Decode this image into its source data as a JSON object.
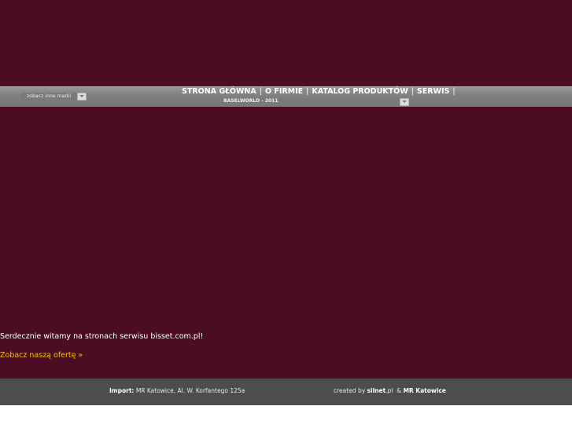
{
  "nav": {
    "brand_select": {
      "label": "zobacz inne marki"
    },
    "menu": [
      {
        "label": "STRONA GŁÓWNA"
      },
      {
        "label": "O FIRMIE"
      },
      {
        "label": "KATALOG PRODUKTÓW"
      },
      {
        "label": "SERWIS"
      }
    ],
    "separator": "|",
    "news_select": {
      "label": "BASELWORLD - 2011"
    }
  },
  "content": {
    "welcome": "Serdecznie witamy na stronach serwisu bisset.com.pl!",
    "offer_link": "Zobacz naszą ofertę »"
  },
  "footer": {
    "import_label": "Import:",
    "import_address": "MR Katowice, Al. W. Korfantego 125a",
    "created_by": "created by",
    "silnet": "silnet",
    "silnet_suffix": ".pl",
    "ampersand": "&",
    "mr": "MR Katowice"
  },
  "colors": {
    "background": "#4a0d24",
    "navbar": "#7e7e7e",
    "footer": "#4d4d4d",
    "link": "#f2c100",
    "text": "#ffffff"
  }
}
